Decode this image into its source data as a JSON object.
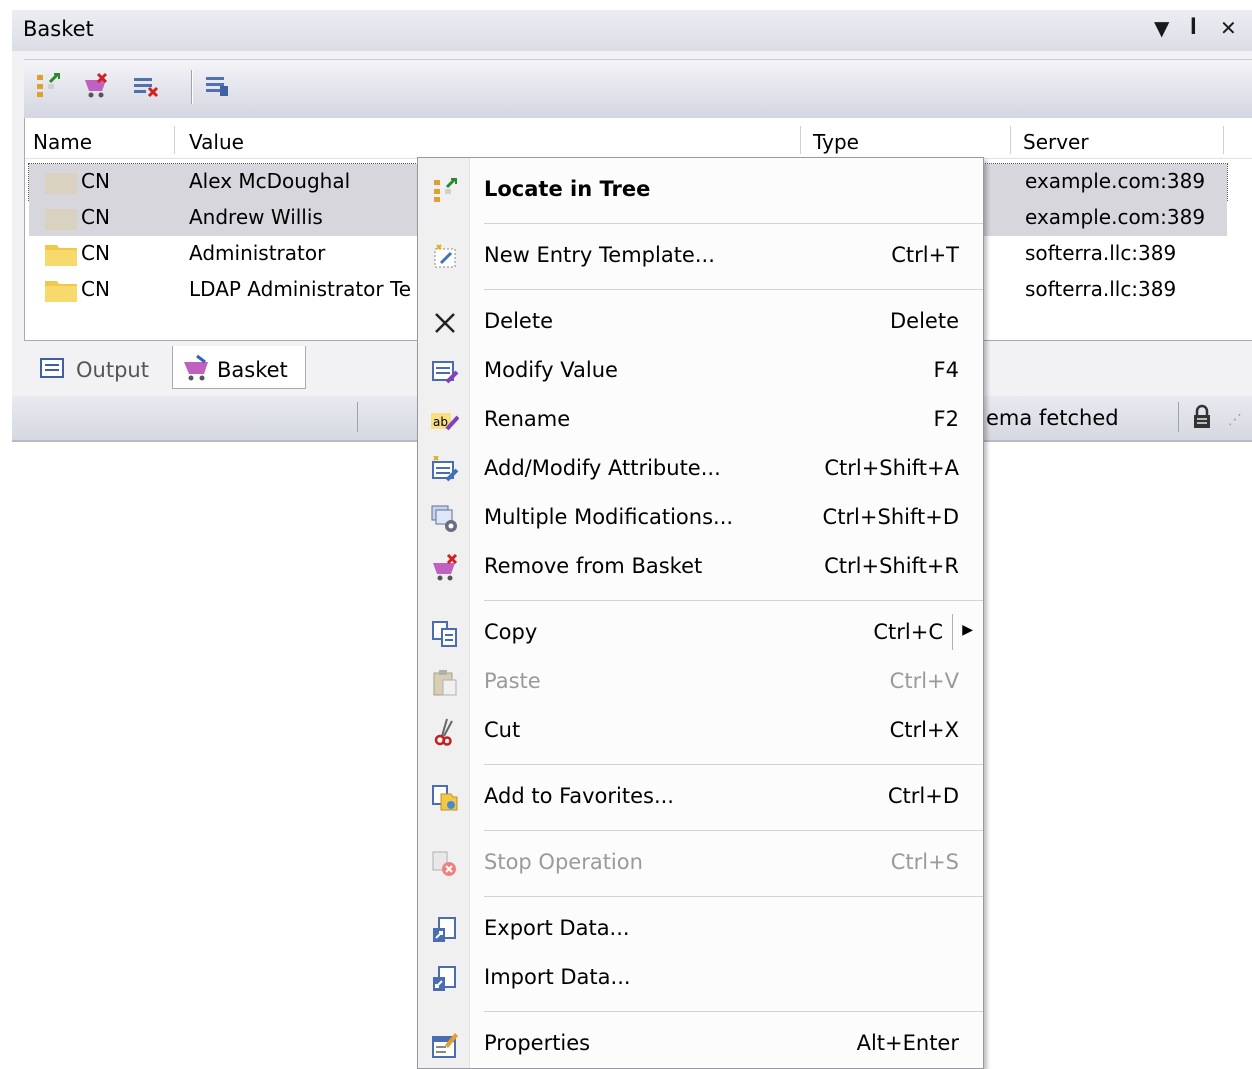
{
  "panel": {
    "title": "Basket",
    "controls": [
      "▾",
      "ᵖ",
      "✕"
    ]
  },
  "list": {
    "columns": [
      "Name",
      "Value",
      "Type",
      "Server"
    ],
    "rows": [
      {
        "name": "CN",
        "value": "Alex McDoughal",
        "server": "example.com:389",
        "selected": true
      },
      {
        "name": "CN",
        "value": "Andrew Willis",
        "server": "example.com:389",
        "selected": true
      },
      {
        "name": "CN",
        "value": "Administrator",
        "server": "softerra.llc:389",
        "selected": false
      },
      {
        "name": "CN",
        "value": "LDAP Administrator Te",
        "server": "softerra.llc:389",
        "selected": false
      }
    ]
  },
  "tabs": [
    {
      "label": "Output",
      "icon": "output-icon",
      "active": false
    },
    {
      "label": "Basket",
      "icon": "basket-icon",
      "active": true
    }
  ],
  "status": {
    "text": "ema fetched",
    "lock_icon": "lock-icon"
  },
  "menu": {
    "items": [
      {
        "id": "locate-in-tree",
        "label": "Locate in Tree",
        "shortcut": "",
        "icon": "locate-tree-icon",
        "bold": true,
        "disabled": false
      },
      {
        "id": "new-entry-template",
        "label": "New Entry Template...",
        "shortcut": "Ctrl+T",
        "icon": "template-icon",
        "disabled": false
      },
      {
        "id": "delete",
        "label": "Delete",
        "shortcut": "Delete",
        "icon": "delete-x-icon",
        "disabled": false
      },
      {
        "id": "modify-value",
        "label": "Modify Value",
        "shortcut": "F4",
        "icon": "modify-value-icon",
        "disabled": false
      },
      {
        "id": "rename",
        "label": "Rename",
        "shortcut": "F2",
        "icon": "rename-icon",
        "disabled": false
      },
      {
        "id": "add-modify-attribute",
        "label": "Add/Modify Attribute...",
        "shortcut": "Ctrl+Shift+A",
        "icon": "add-attribute-icon",
        "disabled": false
      },
      {
        "id": "multiple-modifications",
        "label": "Multiple Modifications...",
        "shortcut": "Ctrl+Shift+D",
        "icon": "multi-modify-icon",
        "disabled": false
      },
      {
        "id": "remove-from-basket",
        "label": "Remove from Basket",
        "shortcut": "Ctrl+Shift+R",
        "icon": "basket-remove-icon",
        "disabled": false
      },
      {
        "id": "copy",
        "label": "Copy",
        "shortcut": "Ctrl+C",
        "icon": "copy-icon",
        "disabled": false,
        "submenu": true
      },
      {
        "id": "paste",
        "label": "Paste",
        "shortcut": "Ctrl+V",
        "icon": "paste-icon",
        "disabled": true
      },
      {
        "id": "cut",
        "label": "Cut",
        "shortcut": "Ctrl+X",
        "icon": "scissors-icon",
        "disabled": false
      },
      {
        "id": "add-to-favorites",
        "label": "Add to Favorites...",
        "shortcut": "Ctrl+D",
        "icon": "favorites-icon",
        "disabled": false
      },
      {
        "id": "stop-operation",
        "label": "Stop Operation",
        "shortcut": "Ctrl+S",
        "icon": "stop-icon",
        "disabled": true
      },
      {
        "id": "export-data",
        "label": "Export Data...",
        "shortcut": "",
        "icon": "export-icon",
        "disabled": false
      },
      {
        "id": "import-data",
        "label": "Import Data...",
        "shortcut": "",
        "icon": "import-icon",
        "disabled": false
      },
      {
        "id": "properties",
        "label": "Properties",
        "shortcut": "Alt+Enter",
        "icon": "properties-icon",
        "disabled": false
      }
    ]
  },
  "colors": {
    "selection": "#d6d6dc",
    "menu_gutter": "#f0f0f0",
    "disabled_text": "#9a9a9a"
  }
}
